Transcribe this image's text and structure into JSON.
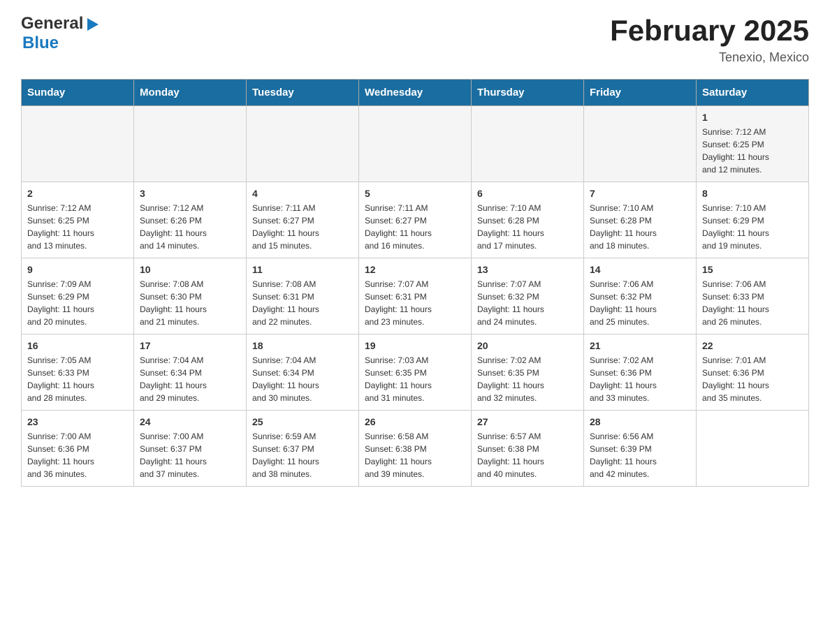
{
  "header": {
    "logo_general": "General",
    "logo_blue": "Blue",
    "month_title": "February 2025",
    "location": "Tenexio, Mexico"
  },
  "days_of_week": [
    "Sunday",
    "Monday",
    "Tuesday",
    "Wednesday",
    "Thursday",
    "Friday",
    "Saturday"
  ],
  "weeks": [
    [
      {
        "day": "",
        "info": ""
      },
      {
        "day": "",
        "info": ""
      },
      {
        "day": "",
        "info": ""
      },
      {
        "day": "",
        "info": ""
      },
      {
        "day": "",
        "info": ""
      },
      {
        "day": "",
        "info": ""
      },
      {
        "day": "1",
        "info": "Sunrise: 7:12 AM\nSunset: 6:25 PM\nDaylight: 11 hours\nand 12 minutes."
      }
    ],
    [
      {
        "day": "2",
        "info": "Sunrise: 7:12 AM\nSunset: 6:25 PM\nDaylight: 11 hours\nand 13 minutes."
      },
      {
        "day": "3",
        "info": "Sunrise: 7:12 AM\nSunset: 6:26 PM\nDaylight: 11 hours\nand 14 minutes."
      },
      {
        "day": "4",
        "info": "Sunrise: 7:11 AM\nSunset: 6:27 PM\nDaylight: 11 hours\nand 15 minutes."
      },
      {
        "day": "5",
        "info": "Sunrise: 7:11 AM\nSunset: 6:27 PM\nDaylight: 11 hours\nand 16 minutes."
      },
      {
        "day": "6",
        "info": "Sunrise: 7:10 AM\nSunset: 6:28 PM\nDaylight: 11 hours\nand 17 minutes."
      },
      {
        "day": "7",
        "info": "Sunrise: 7:10 AM\nSunset: 6:28 PM\nDaylight: 11 hours\nand 18 minutes."
      },
      {
        "day": "8",
        "info": "Sunrise: 7:10 AM\nSunset: 6:29 PM\nDaylight: 11 hours\nand 19 minutes."
      }
    ],
    [
      {
        "day": "9",
        "info": "Sunrise: 7:09 AM\nSunset: 6:29 PM\nDaylight: 11 hours\nand 20 minutes."
      },
      {
        "day": "10",
        "info": "Sunrise: 7:08 AM\nSunset: 6:30 PM\nDaylight: 11 hours\nand 21 minutes."
      },
      {
        "day": "11",
        "info": "Sunrise: 7:08 AM\nSunset: 6:31 PM\nDaylight: 11 hours\nand 22 minutes."
      },
      {
        "day": "12",
        "info": "Sunrise: 7:07 AM\nSunset: 6:31 PM\nDaylight: 11 hours\nand 23 minutes."
      },
      {
        "day": "13",
        "info": "Sunrise: 7:07 AM\nSunset: 6:32 PM\nDaylight: 11 hours\nand 24 minutes."
      },
      {
        "day": "14",
        "info": "Sunrise: 7:06 AM\nSunset: 6:32 PM\nDaylight: 11 hours\nand 25 minutes."
      },
      {
        "day": "15",
        "info": "Sunrise: 7:06 AM\nSunset: 6:33 PM\nDaylight: 11 hours\nand 26 minutes."
      }
    ],
    [
      {
        "day": "16",
        "info": "Sunrise: 7:05 AM\nSunset: 6:33 PM\nDaylight: 11 hours\nand 28 minutes."
      },
      {
        "day": "17",
        "info": "Sunrise: 7:04 AM\nSunset: 6:34 PM\nDaylight: 11 hours\nand 29 minutes."
      },
      {
        "day": "18",
        "info": "Sunrise: 7:04 AM\nSunset: 6:34 PM\nDaylight: 11 hours\nand 30 minutes."
      },
      {
        "day": "19",
        "info": "Sunrise: 7:03 AM\nSunset: 6:35 PM\nDaylight: 11 hours\nand 31 minutes."
      },
      {
        "day": "20",
        "info": "Sunrise: 7:02 AM\nSunset: 6:35 PM\nDaylight: 11 hours\nand 32 minutes."
      },
      {
        "day": "21",
        "info": "Sunrise: 7:02 AM\nSunset: 6:36 PM\nDaylight: 11 hours\nand 33 minutes."
      },
      {
        "day": "22",
        "info": "Sunrise: 7:01 AM\nSunset: 6:36 PM\nDaylight: 11 hours\nand 35 minutes."
      }
    ],
    [
      {
        "day": "23",
        "info": "Sunrise: 7:00 AM\nSunset: 6:36 PM\nDaylight: 11 hours\nand 36 minutes."
      },
      {
        "day": "24",
        "info": "Sunrise: 7:00 AM\nSunset: 6:37 PM\nDaylight: 11 hours\nand 37 minutes."
      },
      {
        "day": "25",
        "info": "Sunrise: 6:59 AM\nSunset: 6:37 PM\nDaylight: 11 hours\nand 38 minutes."
      },
      {
        "day": "26",
        "info": "Sunrise: 6:58 AM\nSunset: 6:38 PM\nDaylight: 11 hours\nand 39 minutes."
      },
      {
        "day": "27",
        "info": "Sunrise: 6:57 AM\nSunset: 6:38 PM\nDaylight: 11 hours\nand 40 minutes."
      },
      {
        "day": "28",
        "info": "Sunrise: 6:56 AM\nSunset: 6:39 PM\nDaylight: 11 hours\nand 42 minutes."
      },
      {
        "day": "",
        "info": ""
      }
    ]
  ]
}
